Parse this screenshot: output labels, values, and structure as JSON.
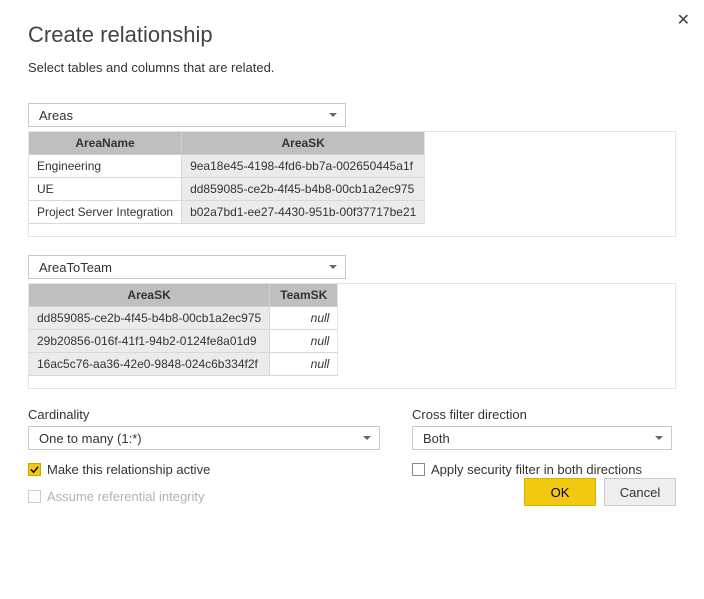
{
  "title": "Create relationship",
  "subtitle": "Select tables and columns that are related.",
  "close_tooltip": "Close",
  "table1": {
    "selected": "Areas",
    "columns": [
      "AreaName",
      "AreaSK"
    ],
    "rows": [
      {
        "c0": "Engineering",
        "c1": "9ea18e45-4198-4fd6-bb7a-002650445a1f"
      },
      {
        "c0": "UE",
        "c1": "dd859085-ce2b-4f45-b4b8-00cb1a2ec975"
      },
      {
        "c0": "Project Server Integration",
        "c1": "b02a7bd1-ee27-4430-951b-00f37717be21"
      }
    ]
  },
  "table2": {
    "selected": "AreaToTeam",
    "columns": [
      "AreaSK",
      "TeamSK"
    ],
    "rows": [
      {
        "c0": "dd859085-ce2b-4f45-b4b8-00cb1a2ec975",
        "c1": "null"
      },
      {
        "c0": "29b20856-016f-41f1-94b2-0124fe8a01d9",
        "c1": "null"
      },
      {
        "c0": "16ac5c76-aa36-42e0-9848-024c6b334f2f",
        "c1": "null"
      }
    ]
  },
  "cardinality": {
    "label": "Cardinality",
    "value": "One to many (1:*)"
  },
  "crossfilter": {
    "label": "Cross filter direction",
    "value": "Both"
  },
  "checks": {
    "active": "Make this relationship active",
    "security": "Apply security filter in both directions",
    "referential": "Assume referential integrity"
  },
  "buttons": {
    "ok": "OK",
    "cancel": "Cancel"
  }
}
